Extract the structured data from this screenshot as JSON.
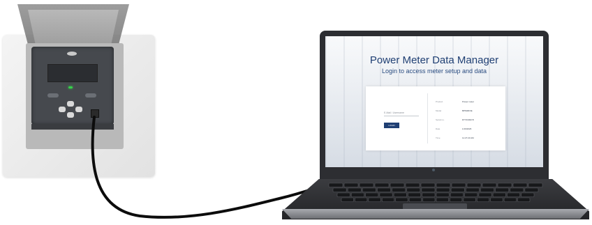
{
  "scene": {
    "device": "power-meter",
    "computer": "laptop"
  },
  "app": {
    "title": "Power Meter Data Manager",
    "subtitle": "Login to access meter setup and data",
    "login": {
      "email_placeholder": "E-Mail / Username",
      "button_label": "LOGIN"
    },
    "info": [
      {
        "key": "Product",
        "value": "Power meter"
      },
      {
        "key": "Model",
        "value": "BPM2ROE"
      },
      {
        "key": "Serial no.",
        "value": "R?723493 B"
      },
      {
        "key": "Date",
        "value": "1/19/2026"
      },
      {
        "key": "Time",
        "value": "11:27:23 AM"
      }
    ]
  },
  "colors": {
    "brand": "#1f3f73",
    "led": "#36d04a"
  }
}
